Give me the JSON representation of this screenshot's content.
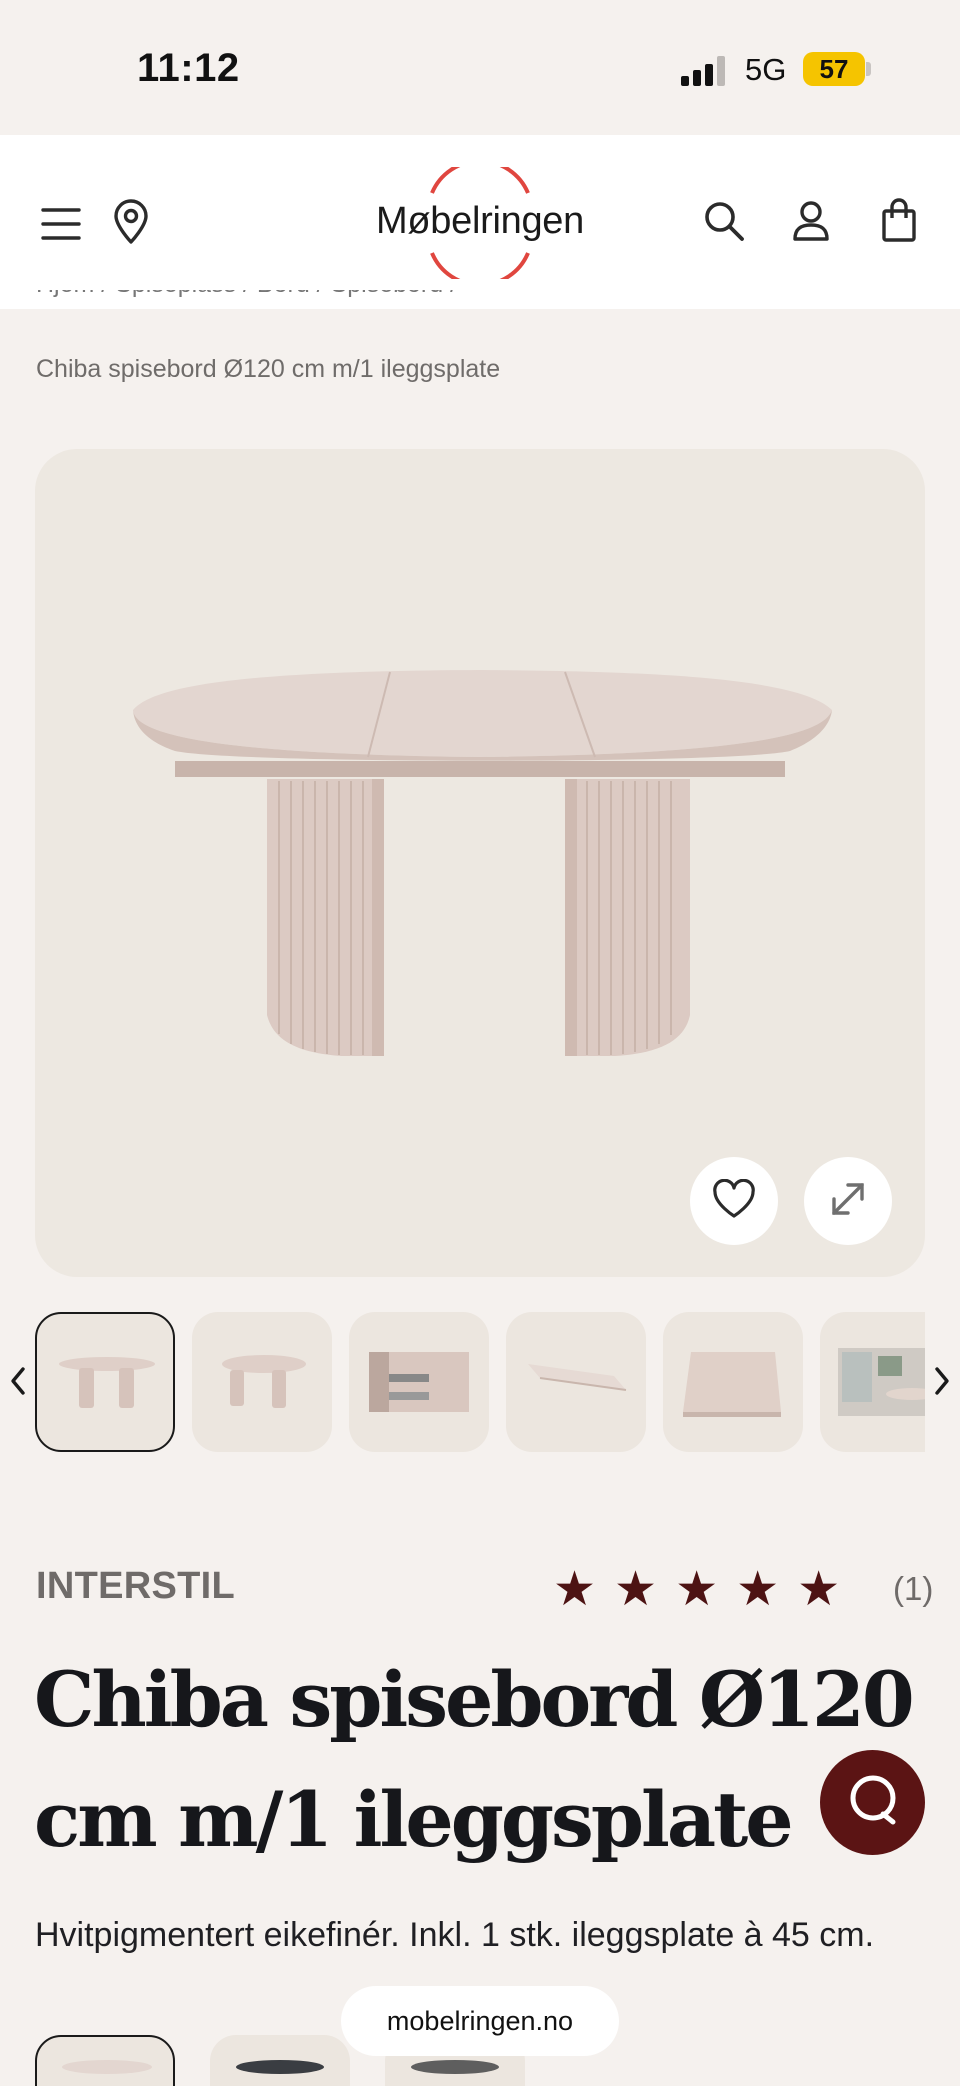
{
  "status_bar": {
    "time": "11:12",
    "network": "5G",
    "battery": "57"
  },
  "header": {
    "logo_text": "Møbelringen",
    "icons": [
      "menu-icon",
      "location-pin-icon",
      "search-icon",
      "user-icon",
      "shopping-bag-icon"
    ]
  },
  "breadcrumb": {
    "partial_text": "Hjem  /  Spiseplass  /  Bord  /  Spisebord  /",
    "current": "Chiba spisebord Ø120 cm m/1 ileggsplate"
  },
  "gallery": {
    "actions": [
      "heart-icon",
      "expand-icon"
    ]
  },
  "product": {
    "brand": "INTERSTIL",
    "stars": [
      "★",
      "★",
      "★",
      "★",
      "★"
    ],
    "rating_count": "(1)",
    "title": "Chiba spisebord Ø120 cm m/1 ileggsplate",
    "description": "Hvitpigmentert eikefinér. Inkl. 1 stk. ileggsplate à 45 cm."
  },
  "browser": {
    "url": "mobelringen.no"
  },
  "colors": {
    "accent": "#4d1313",
    "logo_ring": "#e0463f",
    "background": "#f5f1ee",
    "gallery_bg": "#ede8e1"
  }
}
